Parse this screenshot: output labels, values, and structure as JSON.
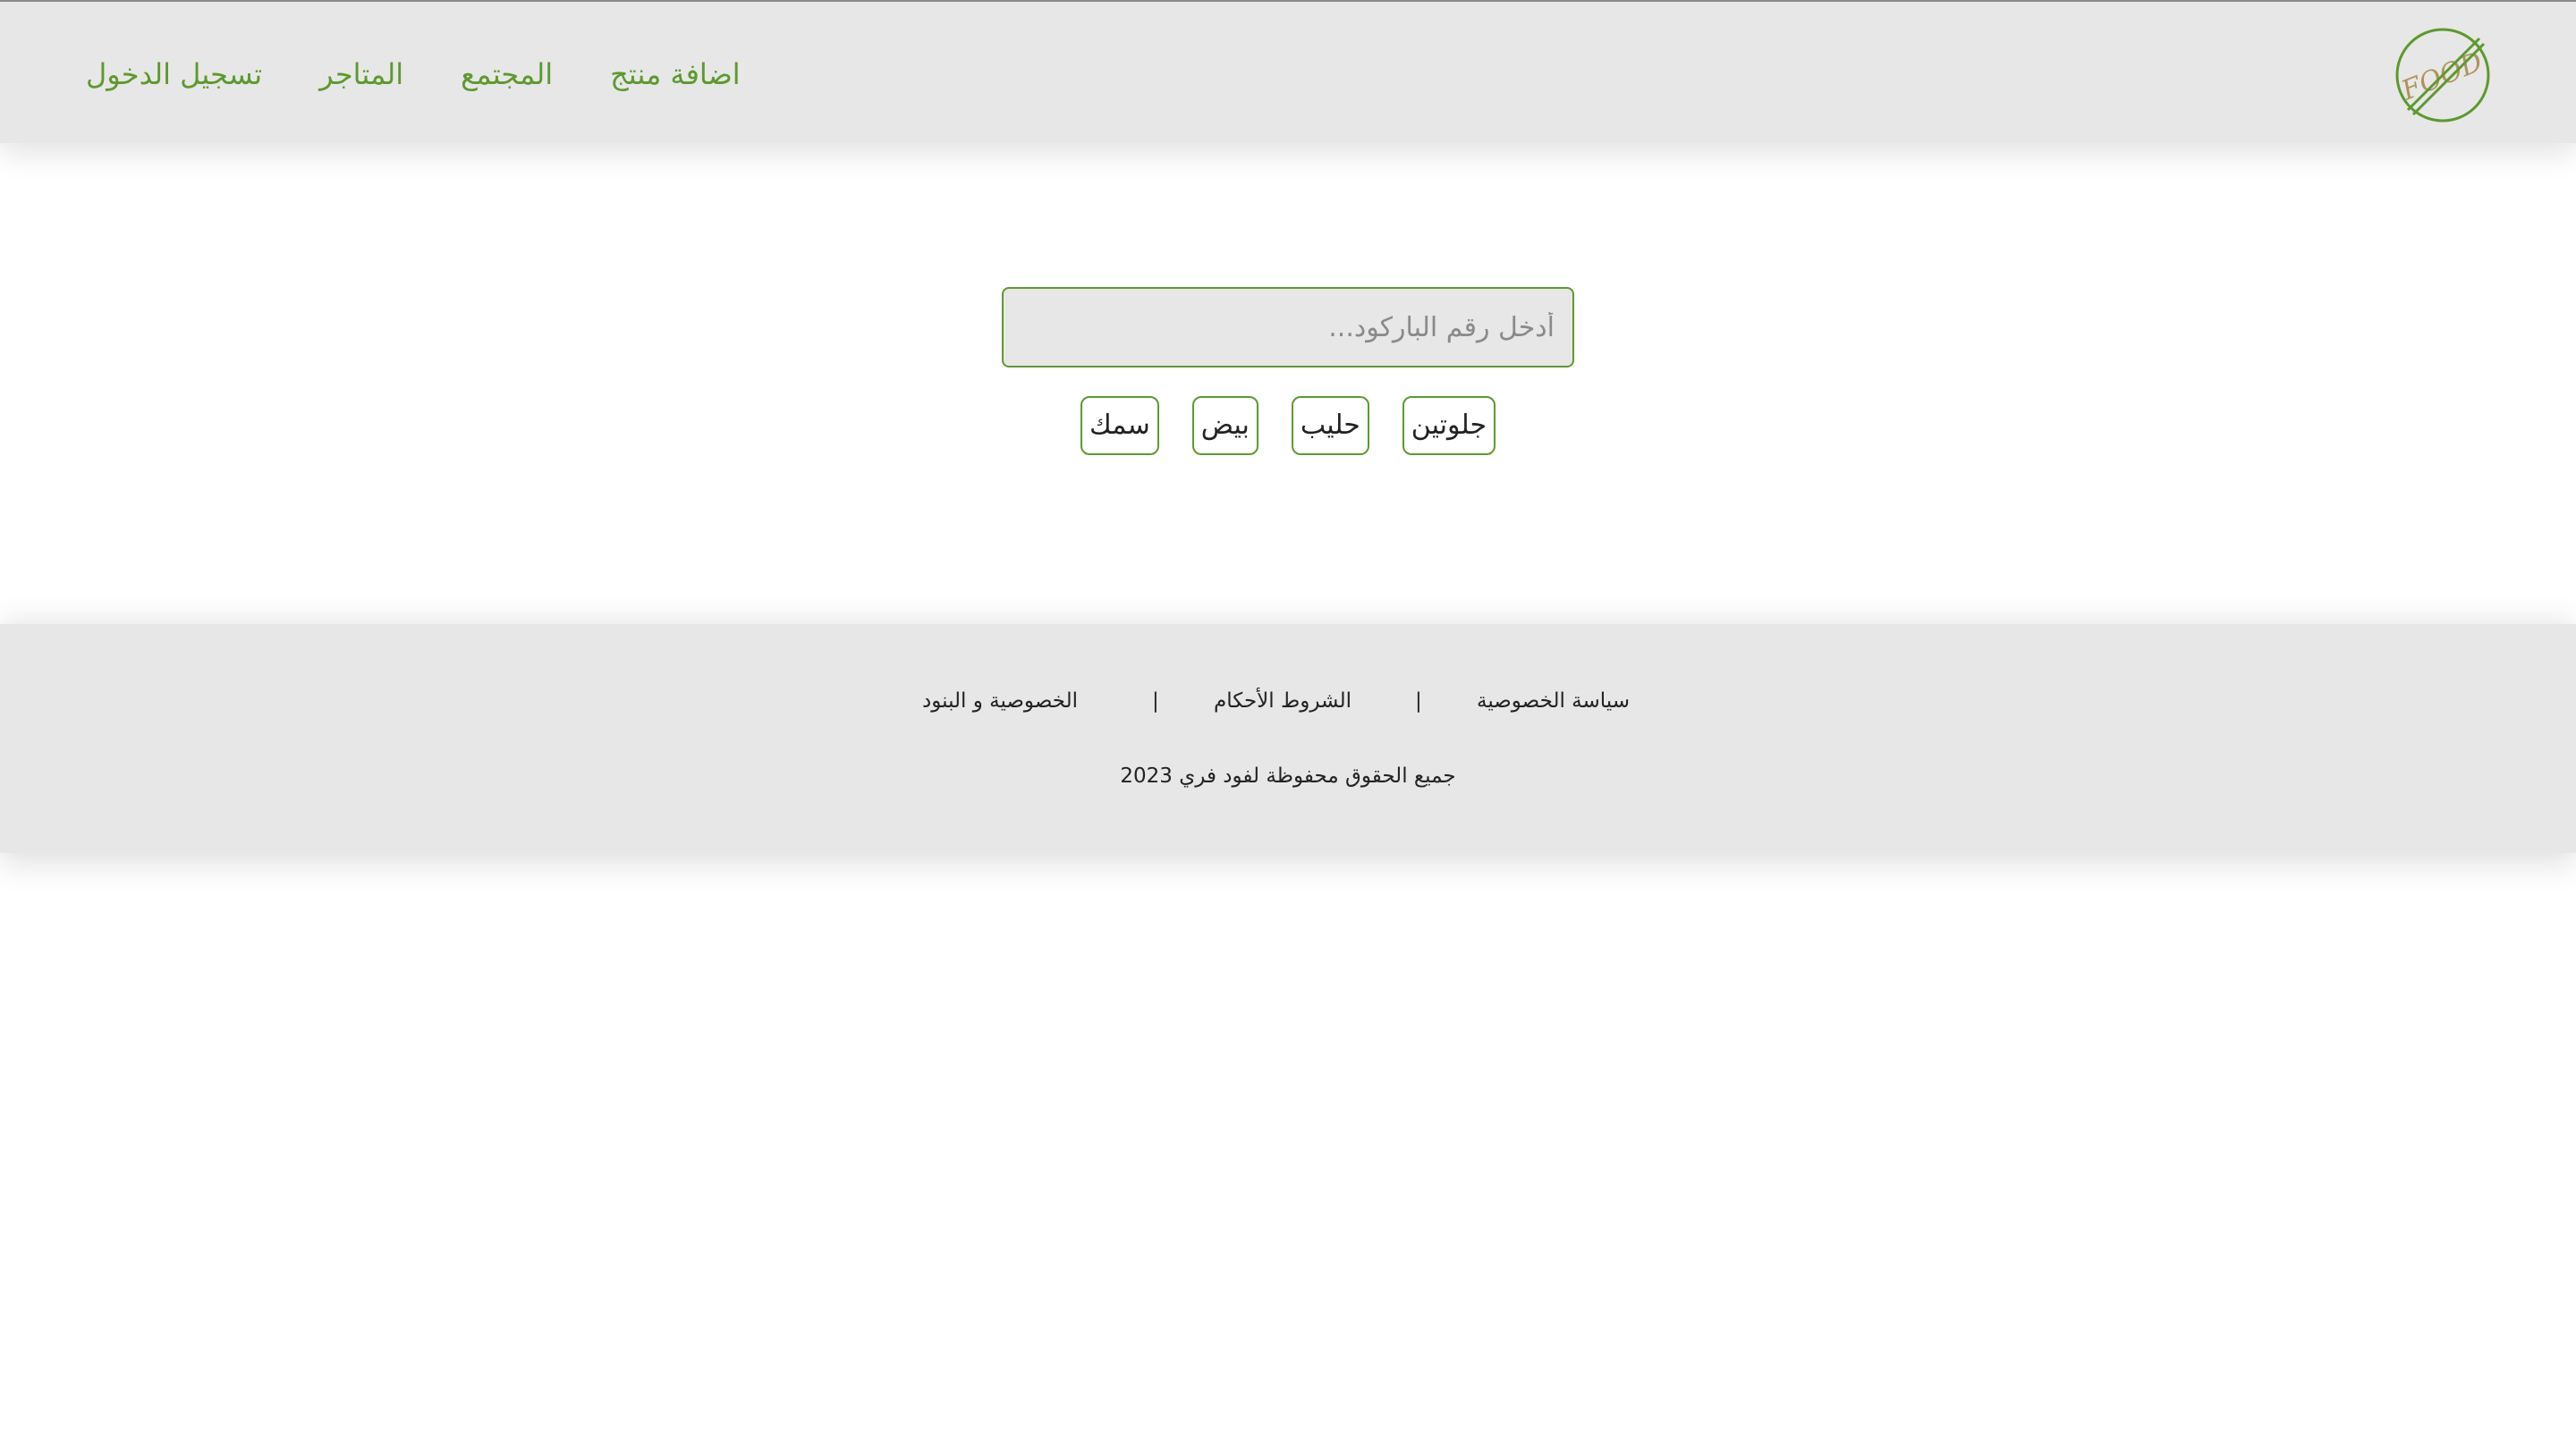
{
  "header": {
    "logo_text": "FOOD",
    "nav": {
      "add_product": "اضافة منتج",
      "community": "المجتمع",
      "stores": "المتاجر",
      "login": "تسجيل الدخول"
    }
  },
  "search": {
    "placeholder": "أدخل رقم الباركود...",
    "value": ""
  },
  "filters": [
    "جلوتين",
    "حليب",
    "بيض",
    "سمك"
  ],
  "footer": {
    "links": {
      "privacy_policy": "سياسة الخصوصية",
      "terms": "الشروط الأحكام",
      "privacy_terms": "الخصوصية و البنود"
    },
    "separator": "|",
    "copyright": "جميع الحقوق محفوظة لفود فري 2023"
  },
  "colors": {
    "accent": "#5c9a2c",
    "header_bg": "#e7e7e7",
    "logo_text": "#b0935a"
  }
}
